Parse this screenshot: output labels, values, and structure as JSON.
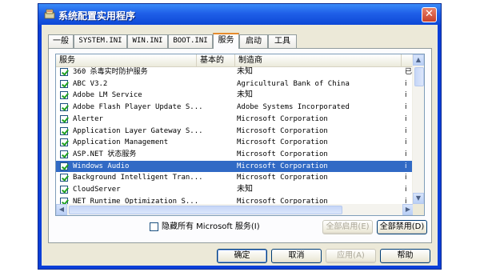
{
  "window": {
    "title": "系统配置实用程序",
    "close_glyph": "✕"
  },
  "tabs": [
    "一般",
    "SYSTEM.INI",
    "WIN.INI",
    "BOOT.INI",
    "服务",
    "启动",
    "工具"
  ],
  "active_tab": "服务",
  "list": {
    "columns": [
      "服务",
      "基本的",
      "制造商"
    ],
    "rows": [
      {
        "service": "360 杀毒实时防护服务",
        "maker": "未知",
        "status": "已",
        "checked": true
      },
      {
        "service": "ABC V3.2",
        "maker": "Agricultural Bank of China",
        "status": "i",
        "checked": true
      },
      {
        "service": "Adobe LM Service",
        "maker": "未知",
        "status": "i",
        "checked": true
      },
      {
        "service": "Adobe Flash Player Update S...",
        "maker": "Adobe Systems Incorporated",
        "status": "i",
        "checked": true
      },
      {
        "service": "Alerter",
        "maker": "Microsoft Corporation",
        "status": "i",
        "checked": true
      },
      {
        "service": "Application Layer Gateway S...",
        "maker": "Microsoft Corporation",
        "status": "i",
        "checked": true
      },
      {
        "service": "Application Management",
        "maker": "Microsoft Corporation",
        "status": "i",
        "checked": true
      },
      {
        "service": "ASP.NET 状态服务",
        "maker": "Microsoft Corporation",
        "status": "i",
        "checked": true
      },
      {
        "service": "Windows Audio",
        "maker": "Microsoft Corporation",
        "status": "i",
        "checked": true,
        "selected": true
      },
      {
        "service": "Background Intelligent Tran...",
        "maker": "Microsoft Corporation",
        "status": "i",
        "checked": true
      },
      {
        "service": "CloudServer",
        "maker": "未知",
        "status": "i",
        "checked": true
      },
      {
        "service": "NET Runtime Optimization S...",
        "maker": "Microsoft Corporation",
        "status": "i",
        "checked": true
      }
    ]
  },
  "hide_ms_label": "隐藏所有 Microsoft 服务(I)",
  "buttons": {
    "enable_all": "全部启用(E)",
    "disable_all": "全部禁用(D)",
    "ok": "确定",
    "cancel": "取消",
    "apply": "应用(A)",
    "help": "帮助"
  },
  "colors": {
    "title_bar": "#1f5fe8",
    "selection": "#316ac5",
    "face": "#ece9d8"
  }
}
